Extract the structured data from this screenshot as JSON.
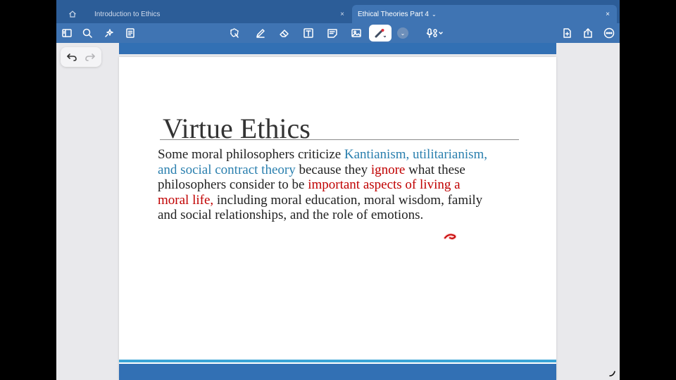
{
  "tabs": {
    "home_icon": "home-icon",
    "tab1_label": "Introduction to Ethics",
    "tab1_close": "×",
    "tab2_label": "Ethical Theories Part 4",
    "tab2_chevron": "⌄",
    "tab2_close": "×"
  },
  "toolbar": {
    "icons": [
      "sidebar-icon",
      "search-icon",
      "ai-sparkle-icon",
      "document-list-icon",
      "lasso-icon",
      "pen-icon",
      "eraser-icon",
      "text-box-icon",
      "sticky-note-icon",
      "image-icon",
      "laser-pointer-icon",
      "color-chevron-icon",
      "microphone-icon",
      "add-page-icon",
      "share-icon",
      "more-icon"
    ],
    "accent_color": "#3f74b3"
  },
  "slide": {
    "title": "Virtue Ethics",
    "l1_a": "Some moral philosophers criticize ",
    "l1_b": "Kantianism, utilitarianism,",
    "l2_a": "and social contract theory",
    "l2_b": " because they ",
    "l2_c": "ignore",
    "l2_d": " what these",
    "l3_a": "philosophers consider to be ",
    "l3_b": "important aspects of living a",
    "l4_a": "moral life,",
    "l4_b": " including moral education, moral wisdom, family",
    "l5": "and social relationships, and the role of emotions.",
    "text_color": "#222222",
    "highlight_blue": "#2a7fae",
    "highlight_red": "#c00000"
  }
}
